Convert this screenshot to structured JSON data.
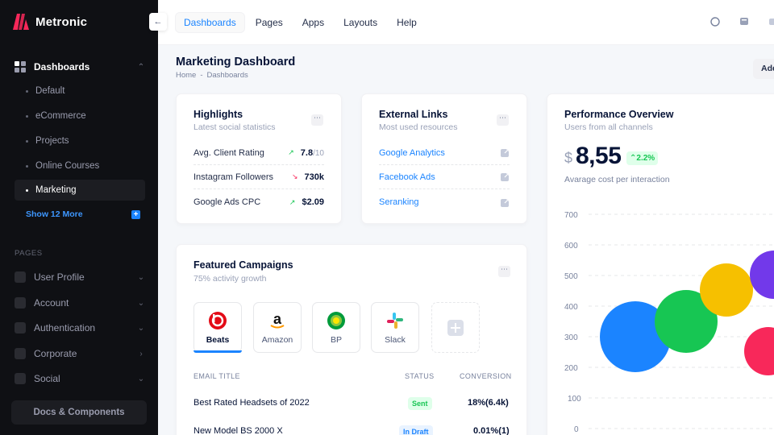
{
  "brand": {
    "name": "Metronic"
  },
  "sidebar": {
    "dashboards": {
      "label": "Dashboards",
      "icon": "grid-icon"
    },
    "sub_items": [
      "Default",
      "eCommerce",
      "Projects",
      "Online Courses",
      "Marketing"
    ],
    "active_item": "Marketing",
    "show_more": "Show 12 More",
    "section_label": "PAGES",
    "pages": [
      {
        "label": "User Profile",
        "icon": "user-icon"
      },
      {
        "label": "Account",
        "icon": "settings-icon"
      },
      {
        "label": "Authentication",
        "icon": "lock-icon"
      },
      {
        "label": "Corporate",
        "icon": "building-icon"
      },
      {
        "label": "Social",
        "icon": "globe-icon"
      }
    ],
    "docs_button": "Docs & Components"
  },
  "topbar": {
    "menu": [
      "Dashboards",
      "Pages",
      "Apps",
      "Layouts",
      "Help"
    ],
    "active_menu": "Dashboards"
  },
  "page": {
    "title": "Marketing Dashboard",
    "breadcrumb": [
      "Home",
      "-",
      "Dashboards"
    ],
    "add_button": "Add"
  },
  "highlights": {
    "title": "Highlights",
    "subtitle": "Latest social statistics",
    "rows": [
      {
        "label": "Avg. Client Rating",
        "value": "7.8",
        "suffix": "/10",
        "trend": "up"
      },
      {
        "label": "Instagram Followers",
        "value": "730k",
        "suffix": "",
        "trend": "down"
      },
      {
        "label": "Google Ads CPC",
        "value": "$2.09",
        "suffix": "",
        "trend": "up"
      }
    ]
  },
  "external_links": {
    "title": "External Links",
    "subtitle": "Most used resources",
    "links": [
      "Google Analytics",
      "Facebook Ads",
      "Seranking"
    ]
  },
  "performance": {
    "title": "Performance Overview",
    "subtitle": "Users from all channels",
    "currency": "$",
    "value": "8,55",
    "trend": "2.2%",
    "caption": "Avarage cost per interaction",
    "y_ticks": [
      "700",
      "600",
      "500",
      "400",
      "300",
      "200",
      "100",
      "0"
    ]
  },
  "campaigns": {
    "title": "Featured Campaigns",
    "subtitle": "75% activity growth",
    "tiles": [
      "Beats",
      "Amazon",
      "BP",
      "Slack"
    ],
    "selected": "Beats",
    "columns": [
      "EMAIL TITLE",
      "STATUS",
      "CONVERSION"
    ],
    "rows": [
      {
        "title": "Best Rated Headsets of 2022",
        "status": "Sent",
        "conversion": "18%(6.4k)"
      },
      {
        "title": "New Model BS 2000 X",
        "status": "In Draft",
        "conversion": "0.01%(1)"
      }
    ]
  },
  "colors": {
    "primary": "#1b84ff",
    "success": "#17c653",
    "danger": "#f8285a",
    "warning": "#f6c000",
    "purple": "#7239ea",
    "sidebar_bg": "#0f1014"
  }
}
